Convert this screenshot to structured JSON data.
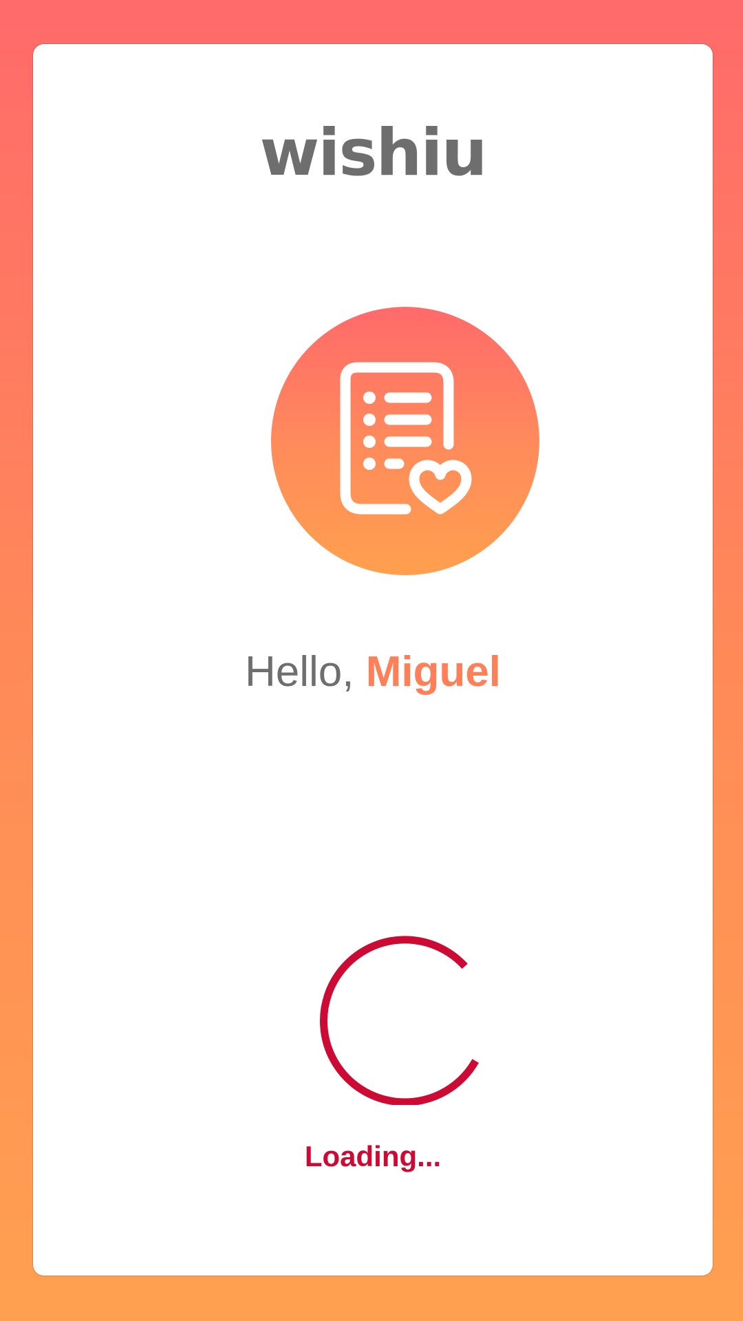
{
  "app": {
    "logo_text": "wishiu"
  },
  "greeting": {
    "prefix": "Hello, ",
    "name": "Miguel"
  },
  "loading": {
    "label": "Loading..."
  },
  "icons": {
    "hero": "wishlist-document-heart-icon",
    "spinner": "loading-spinner-icon"
  },
  "colors": {
    "background_top": "#ff6a6a",
    "background_bottom": "#ffa050",
    "card": "#ffffff",
    "logo": "#6e6e6e",
    "name_accent": "#ff8058",
    "spinner": "#cc0a33"
  }
}
